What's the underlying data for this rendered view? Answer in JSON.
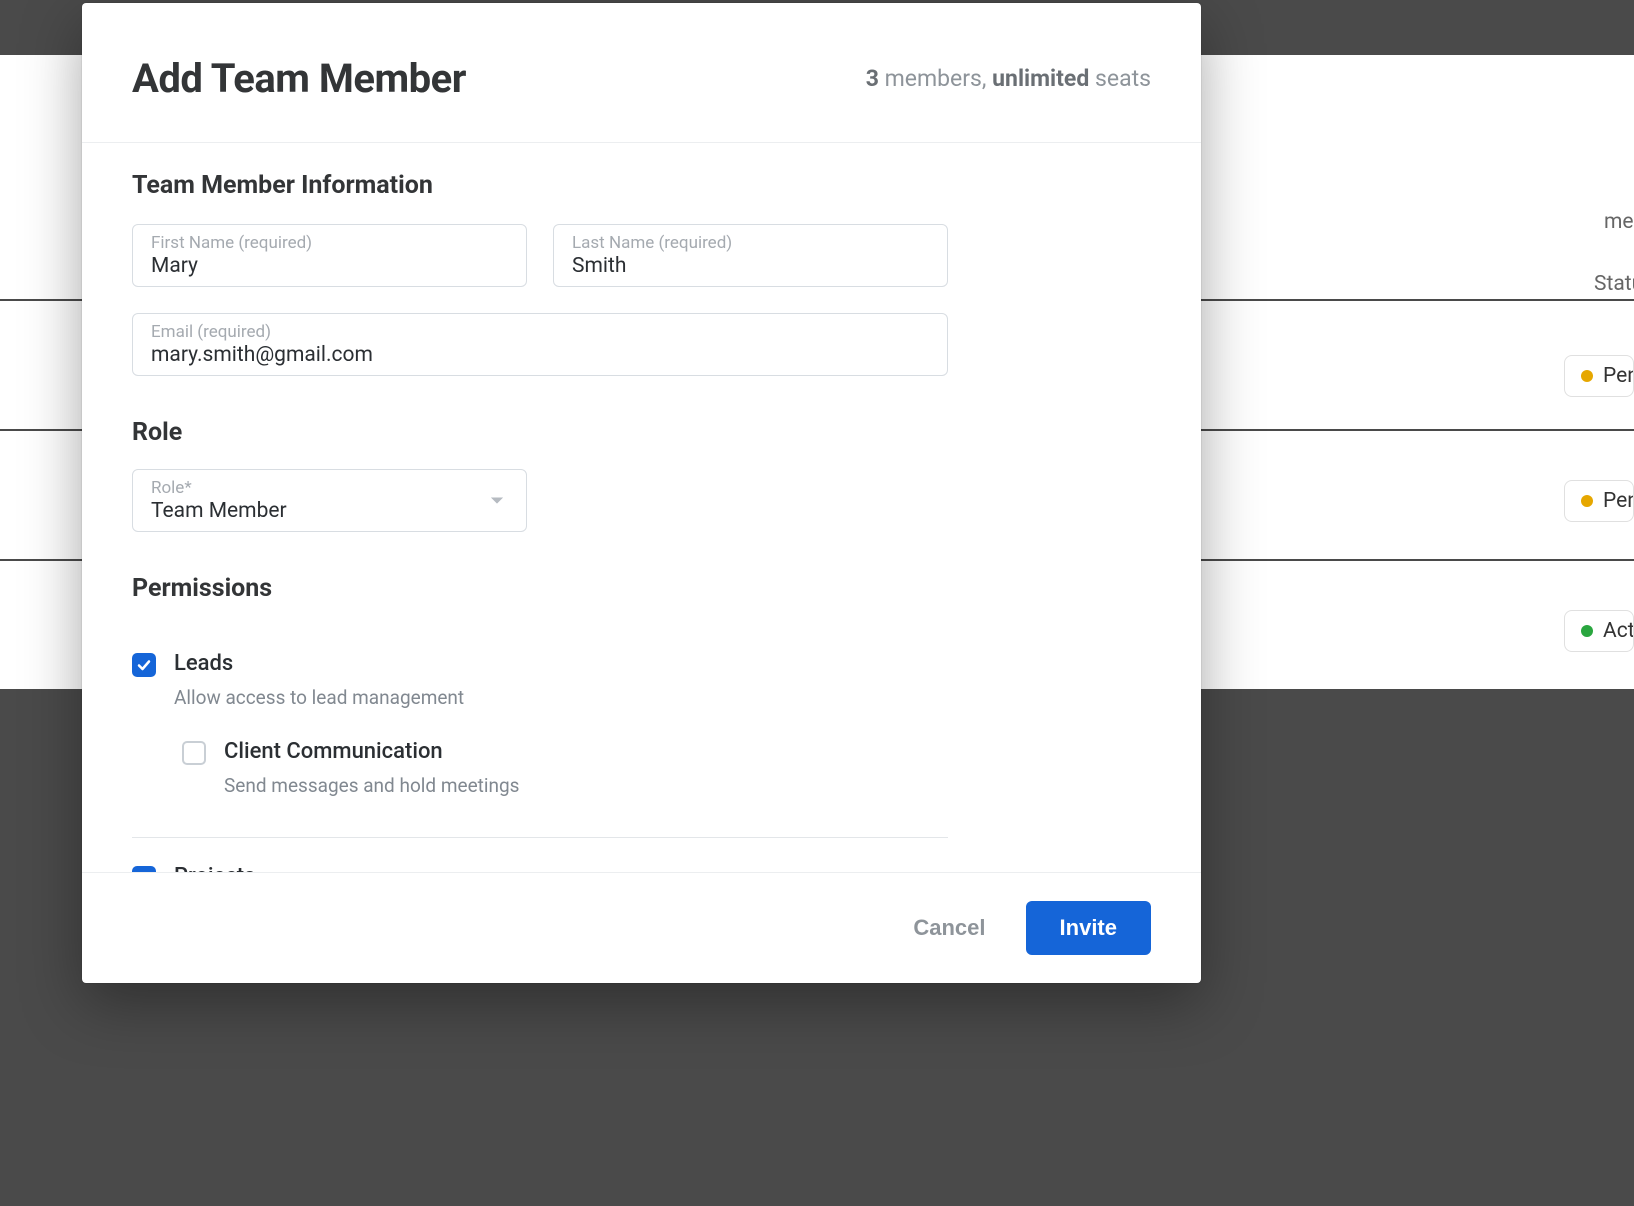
{
  "background": {
    "labels": {
      "members": "members",
      "status": "Status"
    },
    "badges": [
      {
        "color": "amber",
        "text": "Pen"
      },
      {
        "color": "amber",
        "text": "Pen"
      },
      {
        "color": "green",
        "text": "Acti"
      }
    ]
  },
  "modal": {
    "title": "Add Team Member",
    "seats": {
      "count": "3",
      "members_word": "members,",
      "unlimited": "unlimited",
      "seats_word": "seats"
    }
  },
  "sections": {
    "info_heading": "Team Member Information",
    "role_heading": "Role",
    "permissions_heading": "Permissions"
  },
  "fields": {
    "first_name": {
      "label": "First Name (required)",
      "value": "Mary"
    },
    "last_name": {
      "label": "Last Name (required)",
      "value": "Smith"
    },
    "email": {
      "label": "Email (required)",
      "value": "mary.smith@gmail.com"
    },
    "role": {
      "label": "Role*",
      "value": "Team Member"
    }
  },
  "permissions": {
    "leads": {
      "title": "Leads",
      "description": "Allow access to lead management",
      "checked": true
    },
    "client_comm": {
      "title": "Client Communication",
      "description": "Send messages and hold meetings",
      "checked": false
    },
    "projects": {
      "title": "Projects",
      "checked": true
    }
  },
  "footer": {
    "cancel": "Cancel",
    "invite": "Invite"
  }
}
